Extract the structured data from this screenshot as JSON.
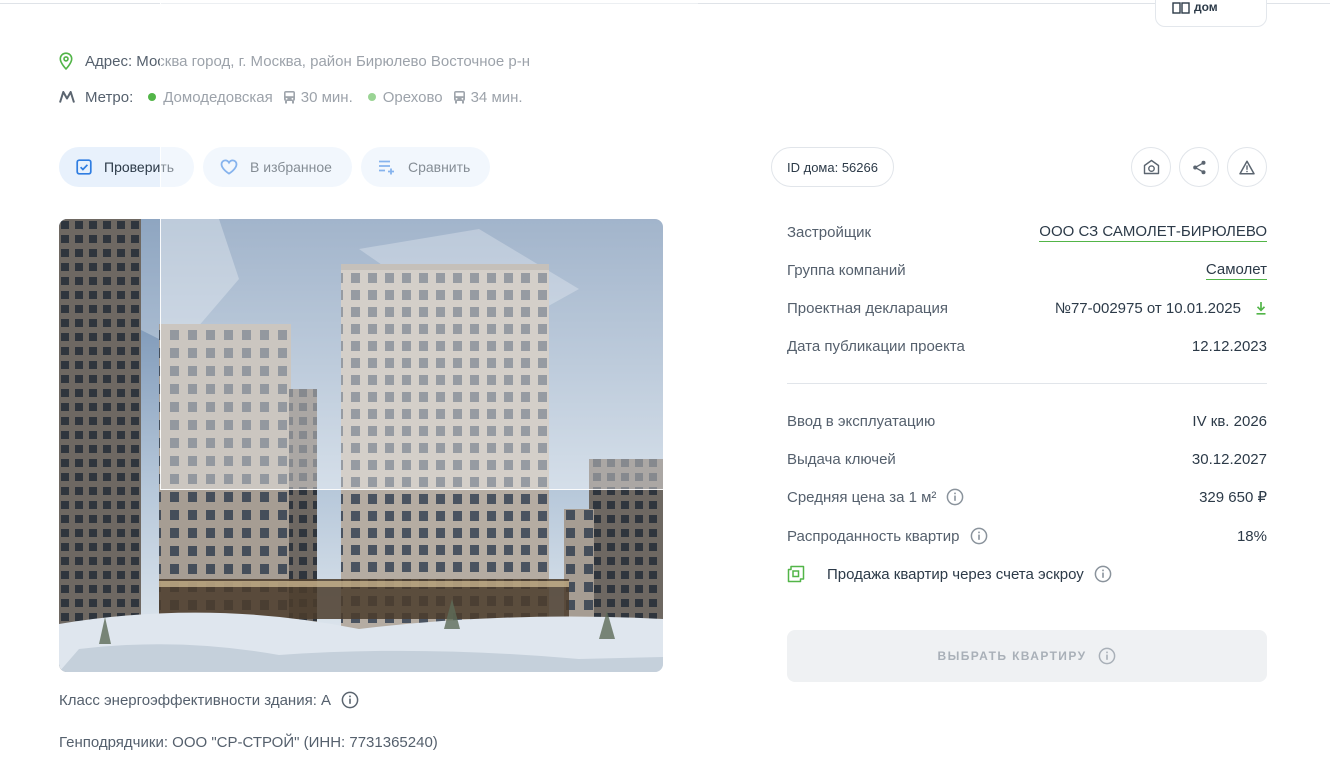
{
  "header": {
    "chip_label": "дом"
  },
  "address": {
    "icon": "location-pin-icon",
    "text": "Адрес: Москва город, г. Москва, район Бирюлево Восточное р-н"
  },
  "metro": {
    "label": "Метро:",
    "stations": [
      {
        "name": "Домодедовская",
        "time": "30 мин.",
        "line_color": "#52b548",
        "transport_icon": "bus-icon"
      },
      {
        "name": "Орехово",
        "time": "34 мин.",
        "line_color": "#52b548",
        "transport_icon": "bus-icon"
      }
    ]
  },
  "actions": {
    "check_label": "Проверить",
    "favorite_label": "В избранное",
    "compare_label": "Сравнить"
  },
  "building": {
    "energy_class": "Класс энергоэффективности здания: А",
    "contractors": "Генподрядчики: ООО \"СР-СТРОЙ\" (ИНН: 7731365240)"
  },
  "house_id": "ID дома: 56266",
  "toolbar_icons": [
    "camera-icon",
    "share-icon",
    "warning-icon"
  ],
  "details": {
    "developer": {
      "label": "Застройщик",
      "value": "ООО СЗ САМОЛЕТ-БИРЮЛЕВО"
    },
    "group": {
      "label": "Группа компаний",
      "value": "Самолет"
    },
    "declaration": {
      "label": "Проектная декларация",
      "value": "№77-002975 от 10.01.2025"
    },
    "published": {
      "label": "Дата публикации проекта",
      "value": "12.12.2023"
    },
    "commissioning": {
      "label": "Ввод в эксплуатацию",
      "value": "IV кв. 2026"
    },
    "keys": {
      "label": "Выдача ключей",
      "value": "30.12.2027"
    },
    "avg_price": {
      "label": "Средняя цена за 1 м²",
      "value": "329 650 ₽"
    },
    "sold": {
      "label": "Распроданность квартир",
      "value": "18%"
    }
  },
  "escrow": {
    "text": "Продажа квартир через счета эскроу"
  },
  "choose_button": {
    "label": "ВЫБРАТЬ КВАРТИРУ",
    "disabled": true
  },
  "colors": {
    "accent_green": "#52b548",
    "button_blue": "#e8f1fc",
    "icon_blue": "#2f7de1"
  }
}
